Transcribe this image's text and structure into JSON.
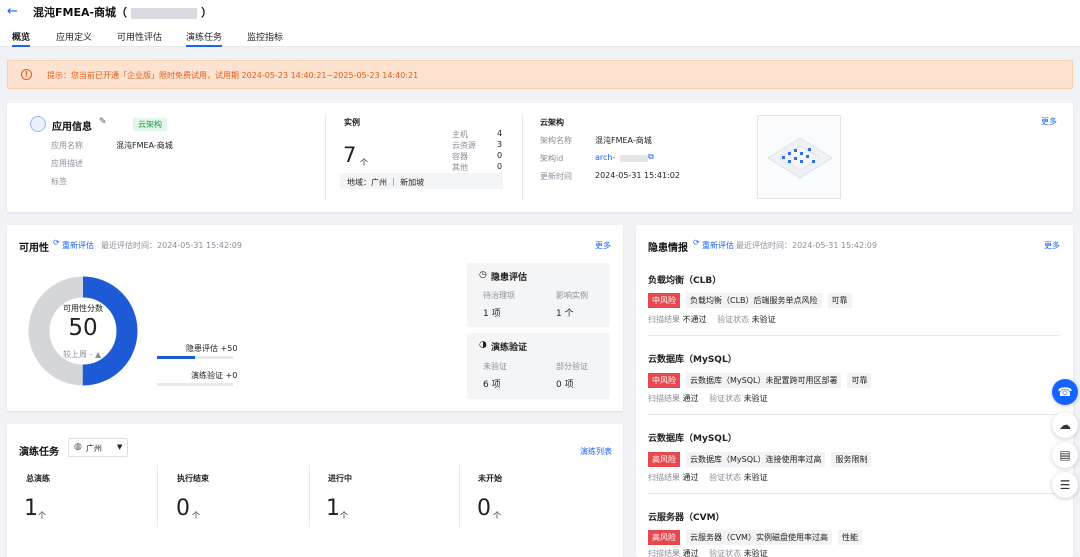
{
  "header": {
    "back_icon": "arrow-left-icon",
    "title_prefix": "混沌FMEA-商城（",
    "title_suffix": "）"
  },
  "tabs": [
    {
      "label": "概览",
      "active": true
    },
    {
      "label": "应用定义",
      "active": false
    },
    {
      "label": "可用性评估",
      "active": false
    },
    {
      "label": "演练任务",
      "active": false
    },
    {
      "label": "监控指标",
      "active": false
    }
  ],
  "notice": {
    "icon": "warning-circle-icon",
    "text": "提示：您当前已开通「企业版」限时免费试用，试用期 2024-05-23 14:40:21~2025-05-23 14:40:21"
  },
  "app_info": {
    "title": "应用信息",
    "tag": "云架构",
    "name_label": "应用名称",
    "name_value": "混沌FMEA-商城",
    "desc_label": "应用描述",
    "tags_label": "标签"
  },
  "instances": {
    "title": "实例",
    "total": "7",
    "unit": "个",
    "rows": [
      {
        "label": "主机",
        "value": "4"
      },
      {
        "label": "云资源",
        "value": "3"
      },
      {
        "label": "容器",
        "value": "0"
      },
      {
        "label": "其他",
        "value": "0"
      }
    ],
    "region": "地域：广州 ｜ 新加坡"
  },
  "cloud_arch": {
    "title": "云架构",
    "rows": [
      {
        "label": "架构名称",
        "value": "混沌FMEA-商城"
      },
      {
        "label": "架构id",
        "value": "arch-"
      },
      {
        "label": "更新时间",
        "value": "2024-05-31 15:41:02"
      }
    ],
    "more": "更多"
  },
  "availability": {
    "title": "可用性",
    "reeval": "重新评估",
    "last_eval": "最近评估时间：2024-05-31 15:42:09",
    "more": "更多",
    "score_label": "可用性分数",
    "score": "50",
    "score_fraction": 0.5,
    "compare": "较上周 - ▲",
    "bar1_label": "隐患评估 +50",
    "bar2_label": "演练验证 +0",
    "risk_box": {
      "title": "隐患评估",
      "col1_label": "待治理项",
      "col1_value": "1 项",
      "col2_label": "影响实例",
      "col2_value": "1 个"
    },
    "drill_box": {
      "title": "演练验证",
      "col1_label": "未验证",
      "col1_value": "6 项",
      "col2_label": "部分验证",
      "col2_value": "0 项"
    },
    "colors": {
      "accent": "#1f5ad6",
      "track": "#d4d6da"
    }
  },
  "drill_tasks": {
    "title": "演练任务",
    "region_select": "广州",
    "list_link": "演练列表",
    "stats": [
      {
        "label": "总演练",
        "value": "1",
        "unit": "个"
      },
      {
        "label": "执行结束",
        "value": "0",
        "unit": "个"
      },
      {
        "label": "进行中",
        "value": "1",
        "unit": "个"
      },
      {
        "label": "未开始",
        "value": "0",
        "unit": "个"
      }
    ]
  },
  "risks": {
    "title": "隐患情报",
    "reeval": "重新评估",
    "last_eval": "最近评估时间：2024-05-31 15:42:09",
    "more": "更多",
    "scan_label": "扫描结果",
    "verify_label": "验证状态",
    "items": [
      {
        "name": "负载均衡（CLB）",
        "level": "中风险",
        "desc": "负载均衡（CLB）后端服务单点风险",
        "category": "可靠",
        "scan": "不通过",
        "verify": "未验证"
      },
      {
        "name": "云数据库（MySQL）",
        "level": "中风险",
        "desc": "云数据库（MySQL）未配置跨可用区部署",
        "category": "可靠",
        "scan": "通过",
        "verify": "未验证"
      },
      {
        "name": "云数据库（MySQL）",
        "level": "高风险",
        "desc": "云数据库（MySQL）连接使用率过高",
        "category": "服务限制",
        "scan": "通过",
        "verify": "未验证"
      },
      {
        "name": "云服务器（CVM）",
        "level": "高风险",
        "desc": "云服务器（CVM）实例磁盘使用率过高",
        "category": "性能",
        "scan": "通过",
        "verify": "未验证"
      }
    ]
  },
  "float_buttons": [
    "headset-icon",
    "cloud-sync-icon",
    "book-icon",
    "list-icon"
  ]
}
